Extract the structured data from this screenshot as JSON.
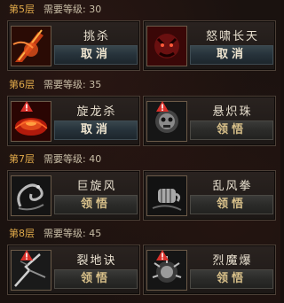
{
  "layers": [
    {
      "header": {
        "layer": "第5层",
        "req_label": "需要等级: 30"
      },
      "skills": [
        {
          "name": "挑杀",
          "action": "取消",
          "state": "learned",
          "icon": "red-blade-icon",
          "warning": false
        },
        {
          "name": "怒啸长天",
          "action": "取消",
          "state": "learned",
          "icon": "demon-roar-icon",
          "warning": false
        }
      ]
    },
    {
      "header": {
        "layer": "第6层",
        "req_label": "需要等级: 35"
      },
      "skills": [
        {
          "name": "旋龙杀",
          "action": "取消",
          "state": "learned",
          "icon": "fire-vortex-icon",
          "warning": true
        },
        {
          "name": "悬炽珠",
          "action": "领悟",
          "state": "locked",
          "icon": "skull-orb-icon",
          "warning": true
        }
      ]
    },
    {
      "header": {
        "layer": "第7层",
        "req_label": "需要等级: 40"
      },
      "skills": [
        {
          "name": "巨旋风",
          "action": "领悟",
          "state": "locked",
          "icon": "dragon-coil-icon",
          "warning": false
        },
        {
          "name": "乱风拳",
          "action": "领悟",
          "state": "locked",
          "icon": "fist-icon",
          "warning": false
        }
      ]
    },
    {
      "header": {
        "layer": "第8层",
        "req_label": "需要等级: 45"
      },
      "skills": [
        {
          "name": "裂地诀",
          "action": "领悟",
          "state": "locked",
          "icon": "ground-split-icon",
          "warning": true
        },
        {
          "name": "烈魔爆",
          "action": "领悟",
          "state": "locked",
          "icon": "demon-burst-icon",
          "warning": true
        }
      ]
    }
  ],
  "colors": {
    "layer_label": "#e0a94a",
    "requirement_text": "#c8bda6",
    "learned_button": "#38464d",
    "locked_button_text": "#d9c18a",
    "warning": "#d9302a"
  }
}
